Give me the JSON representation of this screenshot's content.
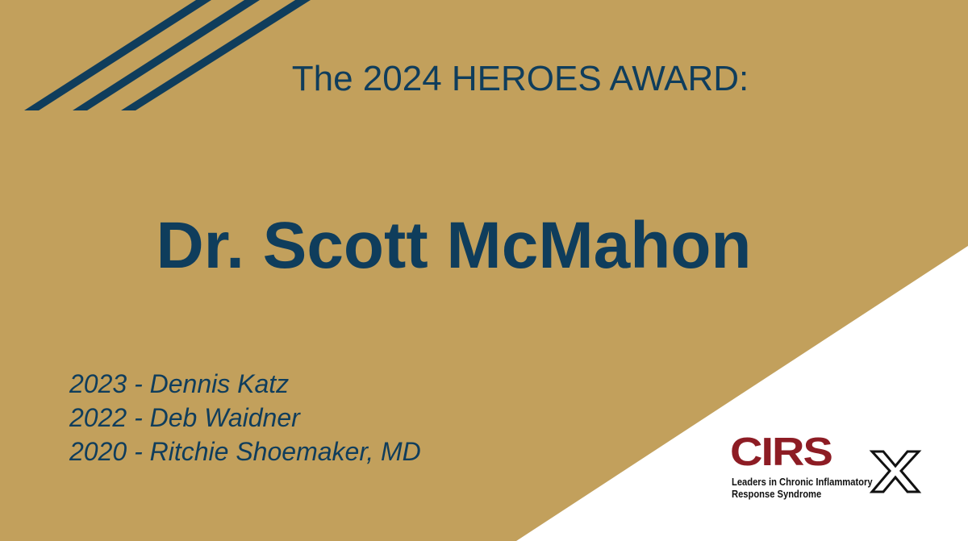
{
  "colors": {
    "gold": "#c2a05c",
    "navy": "#0f3d5c",
    "white": "#ffffff",
    "logo_red": "#8d1c24"
  },
  "slide": {
    "title": "The 2024 HEROES AWARD:",
    "honoree": "Dr. Scott McMahon",
    "past_winners": [
      "2023 - Dennis Katz",
      "2022 - Deb Waidner",
      "2020 - Ritchie Shoemaker, MD"
    ]
  },
  "logo": {
    "main": "CIRS",
    "tagline_line1": "Leaders in Chronic Inflammatory",
    "tagline_line2": "Response Syndrome",
    "icons": [
      "x-mark-icon"
    ]
  }
}
